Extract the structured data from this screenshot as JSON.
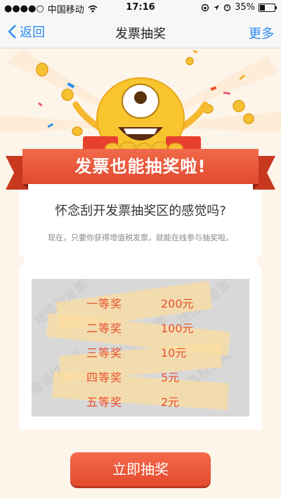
{
  "status_bar": {
    "signal": "●●●●○",
    "carrier": "中国移动",
    "time": "17:16",
    "battery_percent": "35%",
    "battery_level": 0.35
  },
  "nav": {
    "back_label": "返回",
    "title": "发票抽奖",
    "more_label": "更多"
  },
  "banner": {
    "title": "发票也能抽奖啦!"
  },
  "card": {
    "question": "怀念刮开发票抽奖区的感觉吗?",
    "description": "现在，只要你获得增值税发票，就能在线参与抽奖啦。"
  },
  "prizes": [
    {
      "name": "一等奖",
      "amount": "200元"
    },
    {
      "name": "二等奖",
      "amount": "100元"
    },
    {
      "name": "三等奖",
      "amount": "10元"
    },
    {
      "name": "四等奖",
      "amount": "5元"
    },
    {
      "name": "五等奖",
      "amount": "2元"
    }
  ],
  "watermark": "增值税发票",
  "action": {
    "draw_label": "立即抽奖"
  },
  "colors": {
    "accent_blue": "#2a8cf0",
    "primary_red": "#e8502f",
    "background": "#fdf4ea"
  }
}
